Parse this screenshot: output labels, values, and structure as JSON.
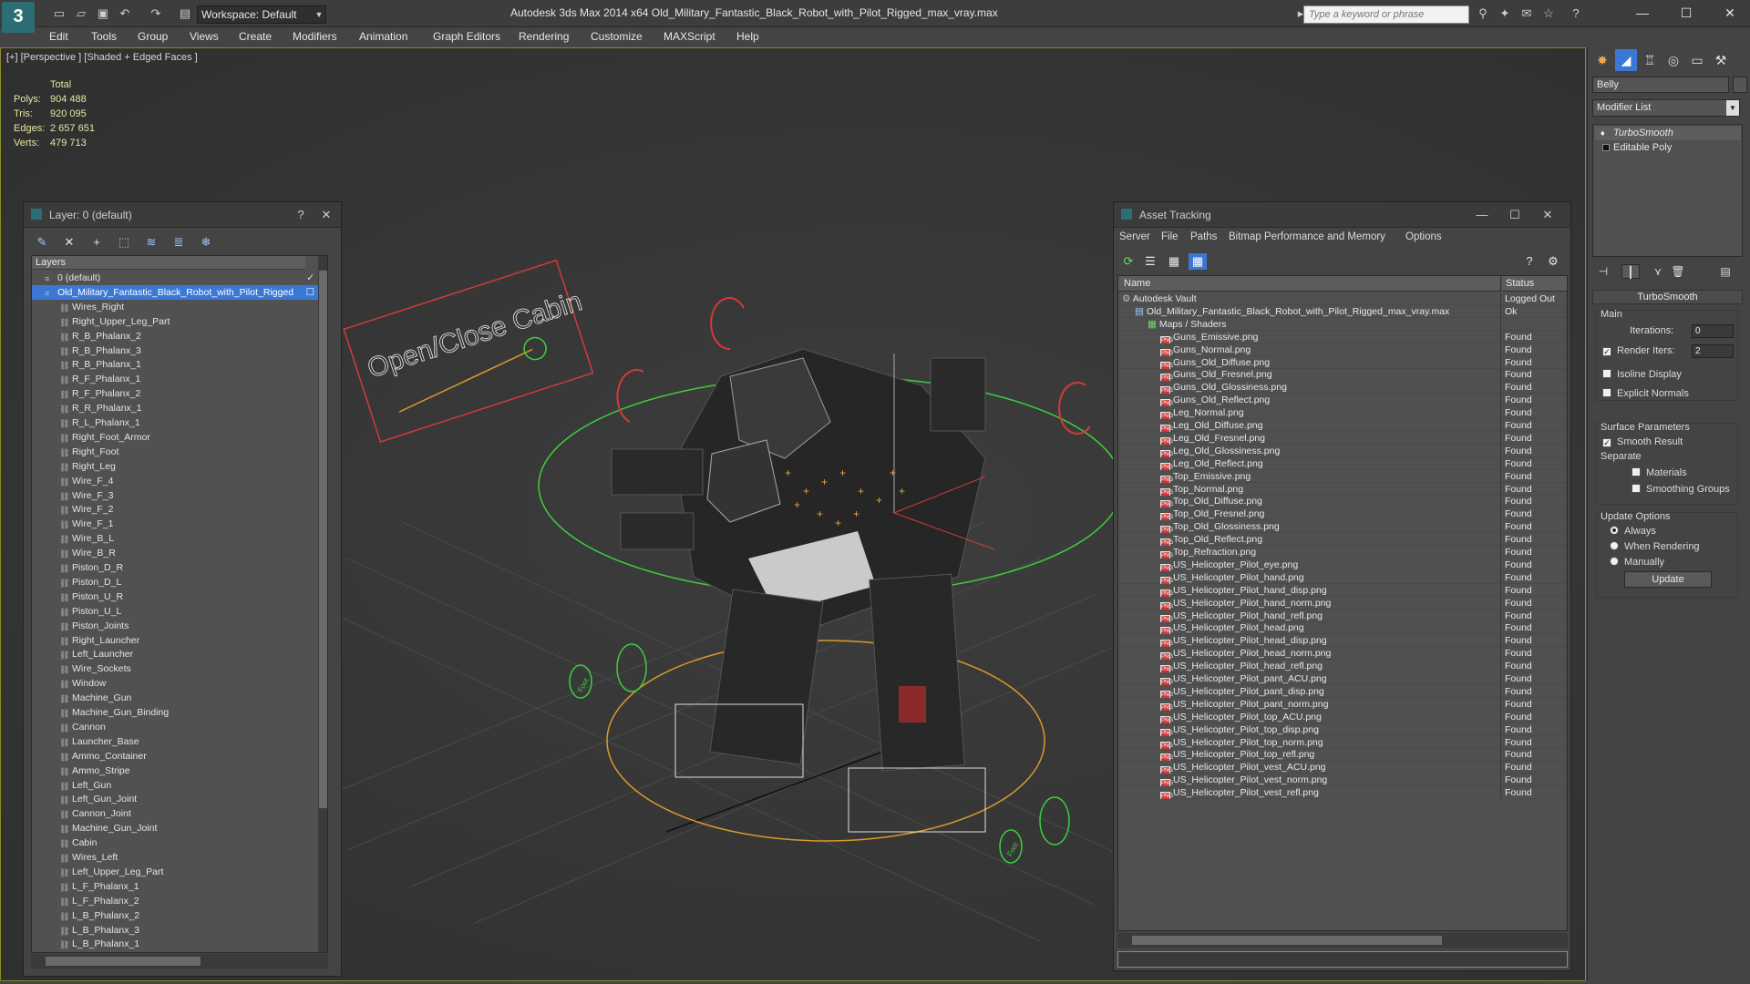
{
  "app": {
    "title": "Autodesk 3ds Max  2014 x64      Old_Military_Fantastic_Black_Robot_with_Pilot_Rigged_max_vray.max",
    "workspace": "Workspace: Default",
    "search_placeholder": "Type a keyword or phrase"
  },
  "menu": [
    "Edit",
    "Tools",
    "Group",
    "Views",
    "Create",
    "Modifiers",
    "Animation",
    "Graph Editors",
    "Rendering",
    "Customize",
    "MAXScript",
    "Help"
  ],
  "viewport": {
    "label": "[+] [Perspective ] [Shaded + Edged Faces ]",
    "stats": {
      "header": "Total",
      "rows": [
        {
          "label": "Polys:",
          "value": "904 488"
        },
        {
          "label": "Tris:",
          "value": "920 095"
        },
        {
          "label": "Edges:",
          "value": "2 657 651"
        },
        {
          "label": "Verts:",
          "value": "479 713"
        }
      ]
    },
    "cabin_text": "Open/Close Cabin",
    "foot_label": "Foot"
  },
  "layer_window": {
    "title": "Layer: 0 (default)",
    "header": "Layers",
    "rows": [
      {
        "label": "0 (default)",
        "level": 1,
        "type": "layer"
      },
      {
        "label": "Old_Military_Fantastic_Black_Robot_with_Pilot_Rigged",
        "level": 1,
        "type": "layer",
        "selected": true
      },
      {
        "label": "Wires_Right",
        "level": 2
      },
      {
        "label": "Right_Upper_Leg_Part",
        "level": 2
      },
      {
        "label": "R_B_Phalanx_2",
        "level": 2
      },
      {
        "label": "R_B_Phalanx_3",
        "level": 2
      },
      {
        "label": "R_B_Phalanx_1",
        "level": 2
      },
      {
        "label": "R_F_Phalanx_1",
        "level": 2
      },
      {
        "label": "R_F_Phalanx_2",
        "level": 2
      },
      {
        "label": "R_R_Phalanx_1",
        "level": 2
      },
      {
        "label": "R_L_Phalanx_1",
        "level": 2
      },
      {
        "label": "Right_Foot_Armor",
        "level": 2
      },
      {
        "label": "Right_Foot",
        "level": 2
      },
      {
        "label": "Right_Leg",
        "level": 2
      },
      {
        "label": "Wire_F_4",
        "level": 2
      },
      {
        "label": "Wire_F_3",
        "level": 2
      },
      {
        "label": "Wire_F_2",
        "level": 2
      },
      {
        "label": "Wire_F_1",
        "level": 2
      },
      {
        "label": "Wire_B_L",
        "level": 2
      },
      {
        "label": "Wire_B_R",
        "level": 2
      },
      {
        "label": "Piston_D_R",
        "level": 2
      },
      {
        "label": "Piston_D_L",
        "level": 2
      },
      {
        "label": "Piston_U_R",
        "level": 2
      },
      {
        "label": "Piston_U_L",
        "level": 2
      },
      {
        "label": "Piston_Joints",
        "level": 2
      },
      {
        "label": "Right_Launcher",
        "level": 2
      },
      {
        "label": "Left_Launcher",
        "level": 2
      },
      {
        "label": "Wire_Sockets",
        "level": 2
      },
      {
        "label": "Window",
        "level": 2
      },
      {
        "label": "Machine_Gun",
        "level": 2
      },
      {
        "label": "Machine_Gun_Binding",
        "level": 2
      },
      {
        "label": "Cannon",
        "level": 2
      },
      {
        "label": "Launcher_Base",
        "level": 2
      },
      {
        "label": "Ammo_Container",
        "level": 2
      },
      {
        "label": "Ammo_Stripe",
        "level": 2
      },
      {
        "label": "Left_Gun",
        "level": 2
      },
      {
        "label": "Left_Gun_Joint",
        "level": 2
      },
      {
        "label": "Cannon_Joint",
        "level": 2
      },
      {
        "label": "Machine_Gun_Joint",
        "level": 2
      },
      {
        "label": "Cabin",
        "level": 2
      },
      {
        "label": "Wires_Left",
        "level": 2
      },
      {
        "label": "Left_Upper_Leg_Part",
        "level": 2
      },
      {
        "label": "L_F_Phalanx_1",
        "level": 2
      },
      {
        "label": "L_F_Phalanx_2",
        "level": 2
      },
      {
        "label": "L_B_Phalanx_2",
        "level": 2
      },
      {
        "label": "L_B_Phalanx_3",
        "level": 2
      },
      {
        "label": "L_B_Phalanx_1",
        "level": 2
      }
    ]
  },
  "asset_window": {
    "title": "Asset Tracking",
    "menu": [
      "Server",
      "File",
      "Paths",
      "Bitmap Performance and Memory",
      "Options"
    ],
    "col_name": "Name",
    "col_status": "Status",
    "rows": [
      {
        "name": "Autodesk Vault",
        "status": "Logged Out",
        "level": 0,
        "type": "vault"
      },
      {
        "name": "Old_Military_Fantastic_Black_Robot_with_Pilot_Rigged_max_vray.max",
        "status": "Ok",
        "level": 1,
        "type": "file"
      },
      {
        "name": "Maps / Shaders",
        "status": "",
        "level": 2,
        "type": "folder"
      },
      {
        "name": "Guns_Emissive.png",
        "status": "Found",
        "level": 3,
        "type": "png"
      },
      {
        "name": "Guns_Normal.png",
        "status": "Found",
        "level": 3,
        "type": "png"
      },
      {
        "name": "Guns_Old_Diffuse.png",
        "status": "Found",
        "level": 3,
        "type": "png"
      },
      {
        "name": "Guns_Old_Fresnel.png",
        "status": "Found",
        "level": 3,
        "type": "png"
      },
      {
        "name": "Guns_Old_Glossiness.png",
        "status": "Found",
        "level": 3,
        "type": "png"
      },
      {
        "name": "Guns_Old_Reflect.png",
        "status": "Found",
        "level": 3,
        "type": "png"
      },
      {
        "name": "Leg_Normal.png",
        "status": "Found",
        "level": 3,
        "type": "png"
      },
      {
        "name": "Leg_Old_Diffuse.png",
        "status": "Found",
        "level": 3,
        "type": "png"
      },
      {
        "name": "Leg_Old_Fresnel.png",
        "status": "Found",
        "level": 3,
        "type": "png"
      },
      {
        "name": "Leg_Old_Glossiness.png",
        "status": "Found",
        "level": 3,
        "type": "png"
      },
      {
        "name": "Leg_Old_Reflect.png",
        "status": "Found",
        "level": 3,
        "type": "png"
      },
      {
        "name": "Top_Emissive.png",
        "status": "Found",
        "level": 3,
        "type": "png"
      },
      {
        "name": "Top_Normal.png",
        "status": "Found",
        "level": 3,
        "type": "png"
      },
      {
        "name": "Top_Old_Diffuse.png",
        "status": "Found",
        "level": 3,
        "type": "png"
      },
      {
        "name": "Top_Old_Fresnel.png",
        "status": "Found",
        "level": 3,
        "type": "png"
      },
      {
        "name": "Top_Old_Glossiness.png",
        "status": "Found",
        "level": 3,
        "type": "png"
      },
      {
        "name": "Top_Old_Reflect.png",
        "status": "Found",
        "level": 3,
        "type": "png"
      },
      {
        "name": "Top_Refraction.png",
        "status": "Found",
        "level": 3,
        "type": "png"
      },
      {
        "name": "US_Helicopter_Pilot_eye.png",
        "status": "Found",
        "level": 3,
        "type": "png"
      },
      {
        "name": "US_Helicopter_Pilot_hand.png",
        "status": "Found",
        "level": 3,
        "type": "png"
      },
      {
        "name": "US_Helicopter_Pilot_hand_disp.png",
        "status": "Found",
        "level": 3,
        "type": "png"
      },
      {
        "name": "US_Helicopter_Pilot_hand_norm.png",
        "status": "Found",
        "level": 3,
        "type": "png"
      },
      {
        "name": "US_Helicopter_Pilot_hand_refl.png",
        "status": "Found",
        "level": 3,
        "type": "png"
      },
      {
        "name": "US_Helicopter_Pilot_head.png",
        "status": "Found",
        "level": 3,
        "type": "png"
      },
      {
        "name": "US_Helicopter_Pilot_head_disp.png",
        "status": "Found",
        "level": 3,
        "type": "png"
      },
      {
        "name": "US_Helicopter_Pilot_head_norm.png",
        "status": "Found",
        "level": 3,
        "type": "png"
      },
      {
        "name": "US_Helicopter_Pilot_head_refl.png",
        "status": "Found",
        "level": 3,
        "type": "png"
      },
      {
        "name": "US_Helicopter_Pilot_pant_ACU.png",
        "status": "Found",
        "level": 3,
        "type": "png"
      },
      {
        "name": "US_Helicopter_Pilot_pant_disp.png",
        "status": "Found",
        "level": 3,
        "type": "png"
      },
      {
        "name": "US_Helicopter_Pilot_pant_norm.png",
        "status": "Found",
        "level": 3,
        "type": "png"
      },
      {
        "name": "US_Helicopter_Pilot_top_ACU.png",
        "status": "Found",
        "level": 3,
        "type": "png"
      },
      {
        "name": "US_Helicopter_Pilot_top_disp.png",
        "status": "Found",
        "level": 3,
        "type": "png"
      },
      {
        "name": "US_Helicopter_Pilot_top_norm.png",
        "status": "Found",
        "level": 3,
        "type": "png"
      },
      {
        "name": "US_Helicopter_Pilot_top_refl.png",
        "status": "Found",
        "level": 3,
        "type": "png"
      },
      {
        "name": "US_Helicopter_Pilot_vest_ACU.png",
        "status": "Found",
        "level": 3,
        "type": "png"
      },
      {
        "name": "US_Helicopter_Pilot_vest_norm.png",
        "status": "Found",
        "level": 3,
        "type": "png"
      },
      {
        "name": "US_Helicopter_Pilot_vest_refl.png",
        "status": "Found",
        "level": 3,
        "type": "png"
      }
    ]
  },
  "command_panel": {
    "object_name": "Belly",
    "modifier_list": "Modifier List",
    "stack": [
      "TurboSmooth",
      "Editable Poly"
    ],
    "rollout": "TurboSmooth",
    "main_group": "Main",
    "iterations_label": "Iterations:",
    "iterations_value": "0",
    "render_iters_label": "Render Iters:",
    "render_iters_value": "2",
    "isoline_label": "Isoline Display",
    "explicit_label": "Explicit Normals",
    "surface_group": "Surface Parameters",
    "smooth_result_label": "Smooth Result",
    "separate_label": "Separate",
    "materials_label": "Materials",
    "smoothing_groups_label": "Smoothing Groups",
    "update_group": "Update Options",
    "always_label": "Always",
    "when_rendering_label": "When Rendering",
    "manually_label": "Manually",
    "update_button": "Update"
  },
  "colors": {
    "selection": "#3b78d6",
    "png_icon": "#c83a3a",
    "spline_red": "#d43a3a",
    "helper_green": "#3ccf3c",
    "ground_orange": "#d89a2a"
  }
}
